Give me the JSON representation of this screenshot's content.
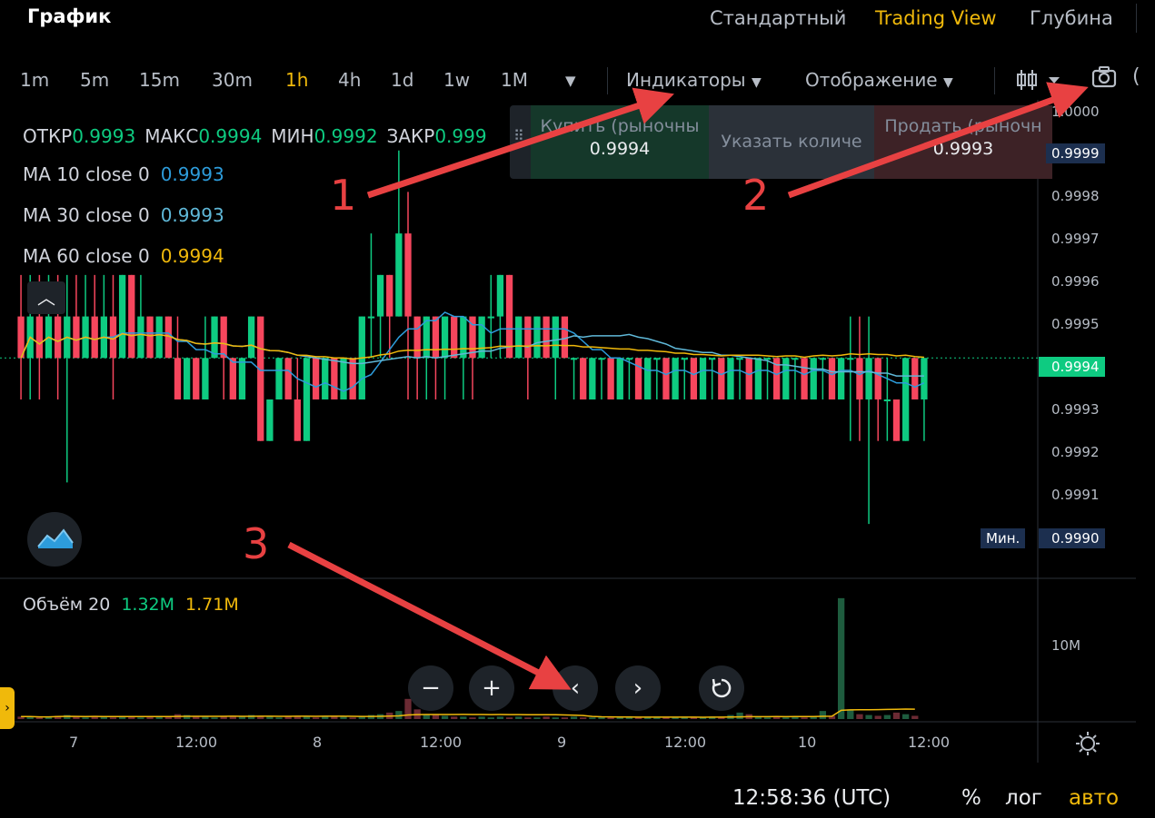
{
  "header": {
    "title": "График",
    "view_tabs": [
      "Стандартный",
      "Trading View",
      "Глубина"
    ],
    "active_view": "Trading View"
  },
  "timeframes": [
    "1m",
    "5m",
    "15m",
    "30m",
    "1h",
    "4h",
    "1d",
    "1w",
    "1M"
  ],
  "active_timeframe": "1h",
  "toolbar": {
    "indicators_label": "Индикаторы",
    "display_label": "Отображение",
    "dropdown_icon": "caret-down-icon",
    "chart_type_icon": "candlestick-icon",
    "screenshot_icon": "camera-icon"
  },
  "ohlc": {
    "open_label": "ОТКР",
    "open_value": "0.9993",
    "high_label": "МАКС",
    "high_value": "0.9994",
    "low_label": "МИН",
    "low_value": "0.9992",
    "close_label": "ЗАКР",
    "close_value": "0.999"
  },
  "ma": [
    {
      "label": "MA 10 close 0",
      "value": "0.9993",
      "color": "#2d9cdb"
    },
    {
      "label": "MA 30 close 0",
      "value": "0.9993",
      "color": "#5fb8d8"
    },
    {
      "label": "MA 60 close 0",
      "value": "0.9994",
      "color": "#f0b90b"
    }
  ],
  "trade_panel": {
    "buy_label": "Купить (рыночны",
    "buy_price": "0.9994",
    "qty_placeholder": "Указать количе",
    "sell_label": "Продать (рыночн",
    "sell_price": "0.9993"
  },
  "price_axis": {
    "top_partial": "1.0000",
    "labels": [
      "0.9998",
      "0.9997",
      "0.9996",
      "0.9995",
      "0.9993",
      "0.9992",
      "0.9991"
    ],
    "high_tag": "0.9999",
    "current_tag": "0.9994",
    "min_label": "Мин.",
    "min_tag": "0.9990"
  },
  "volume": {
    "label": "Объём 20",
    "value1": "1.32M",
    "value2": "1.71M",
    "axis_label": "10M"
  },
  "time_axis": [
    "7",
    "12:00",
    "8",
    "12:00",
    "9",
    "12:00",
    "10",
    "12:00"
  ],
  "nav_buttons": [
    "minus-icon",
    "plus-icon",
    "chevron-left-icon",
    "chevron-right-icon",
    "reset-icon"
  ],
  "annotations": [
    "1",
    "2",
    "3"
  ],
  "bottom_bar": {
    "clock": "12:58:36 (UTC)",
    "percent": "%",
    "log": "лог",
    "auto": "авто"
  },
  "colors": {
    "up": "#0ecb81",
    "down": "#f6465d",
    "accent": "#f0b90b",
    "annotation": "#e84142",
    "current_price": "#0ecb81"
  },
  "chart_data": {
    "type": "candlestick",
    "candles": [
      {
        "o": 0.9995,
        "h": 0.9996,
        "l": 0.9993,
        "c": 0.9994
      },
      {
        "o": 0.9994,
        "h": 0.9996,
        "l": 0.9993,
        "c": 0.9995
      },
      {
        "o": 0.9995,
        "h": 0.9996,
        "l": 0.9993,
        "c": 0.9994
      },
      {
        "o": 0.9994,
        "h": 0.9996,
        "l": 0.9994,
        "c": 0.9995
      },
      {
        "o": 0.9995,
        "h": 0.9996,
        "l": 0.9993,
        "c": 0.9994
      },
      {
        "o": 0.9994,
        "h": 0.9996,
        "l": 0.9991,
        "c": 0.9995
      },
      {
        "o": 0.9995,
        "h": 0.9996,
        "l": 0.9994,
        "c": 0.9994
      },
      {
        "o": 0.9994,
        "h": 0.9996,
        "l": 0.9994,
        "c": 0.9995
      },
      {
        "o": 0.9995,
        "h": 0.9996,
        "l": 0.9994,
        "c": 0.9994
      },
      {
        "o": 0.9994,
        "h": 0.9996,
        "l": 0.9994,
        "c": 0.9995
      },
      {
        "o": 0.9995,
        "h": 0.9996,
        "l": 0.9993,
        "c": 0.9994
      },
      {
        "o": 0.9994,
        "h": 0.9996,
        "l": 0.9994,
        "c": 0.9996
      },
      {
        "o": 0.9996,
        "h": 0.9996,
        "l": 0.9994,
        "c": 0.9994
      },
      {
        "o": 0.9994,
        "h": 0.9996,
        "l": 0.9994,
        "c": 0.9995
      },
      {
        "o": 0.9995,
        "h": 0.9995,
        "l": 0.9994,
        "c": 0.9994
      },
      {
        "o": 0.9994,
        "h": 0.9995,
        "l": 0.9994,
        "c": 0.9995
      },
      {
        "o": 0.9995,
        "h": 0.9995,
        "l": 0.9994,
        "c": 0.9994
      },
      {
        "o": 0.9994,
        "h": 0.9995,
        "l": 0.9993,
        "c": 0.9993
      },
      {
        "o": 0.9993,
        "h": 0.9994,
        "l": 0.9993,
        "c": 0.9994
      },
      {
        "o": 0.9994,
        "h": 0.9994,
        "l": 0.9993,
        "c": 0.9993
      },
      {
        "o": 0.9993,
        "h": 0.9995,
        "l": 0.9993,
        "c": 0.9994
      },
      {
        "o": 0.9994,
        "h": 0.9995,
        "l": 0.9994,
        "c": 0.9995
      },
      {
        "o": 0.9995,
        "h": 0.9995,
        "l": 0.9993,
        "c": 0.9994
      },
      {
        "o": 0.9994,
        "h": 0.9994,
        "l": 0.9993,
        "c": 0.9993
      },
      {
        "o": 0.9993,
        "h": 0.9994,
        "l": 0.9993,
        "c": 0.9994
      },
      {
        "o": 0.9994,
        "h": 0.9995,
        "l": 0.9994,
        "c": 0.9995
      },
      {
        "o": 0.9995,
        "h": 0.9995,
        "l": 0.9992,
        "c": 0.9992
      },
      {
        "o": 0.9992,
        "h": 0.9993,
        "l": 0.9992,
        "c": 0.9993
      },
      {
        "o": 0.9993,
        "h": 0.9994,
        "l": 0.9993,
        "c": 0.9994
      },
      {
        "o": 0.9994,
        "h": 0.9994,
        "l": 0.9993,
        "c": 0.9993
      },
      {
        "o": 0.9993,
        "h": 0.9994,
        "l": 0.9992,
        "c": 0.9992
      },
      {
        "o": 0.9992,
        "h": 0.9994,
        "l": 0.9992,
        "c": 0.9994
      },
      {
        "o": 0.9994,
        "h": 0.9994,
        "l": 0.9993,
        "c": 0.9993
      },
      {
        "o": 0.9993,
        "h": 0.9994,
        "l": 0.9993,
        "c": 0.9994
      },
      {
        "o": 0.9994,
        "h": 0.9994,
        "l": 0.9993,
        "c": 0.9993
      },
      {
        "o": 0.9993,
        "h": 0.9994,
        "l": 0.9993,
        "c": 0.9994
      },
      {
        "o": 0.9994,
        "h": 0.9994,
        "l": 0.9993,
        "c": 0.9993
      },
      {
        "o": 0.9993,
        "h": 0.9995,
        "l": 0.9993,
        "c": 0.9995
      },
      {
        "o": 0.9995,
        "h": 0.9997,
        "l": 0.9994,
        "c": 0.9995
      },
      {
        "o": 0.9995,
        "h": 0.9996,
        "l": 0.9994,
        "c": 0.9996
      },
      {
        "o": 0.9996,
        "h": 0.9996,
        "l": 0.9994,
        "c": 0.9995
      },
      {
        "o": 0.9995,
        "h": 0.9999,
        "l": 0.9995,
        "c": 0.9997
      },
      {
        "o": 0.9997,
        "h": 0.9998,
        "l": 0.9993,
        "c": 0.9995
      },
      {
        "o": 0.9995,
        "h": 0.9995,
        "l": 0.9993,
        "c": 0.9994
      },
      {
        "o": 0.9994,
        "h": 0.9995,
        "l": 0.9993,
        "c": 0.9995
      },
      {
        "o": 0.9995,
        "h": 0.9995,
        "l": 0.9993,
        "c": 0.9994
      },
      {
        "o": 0.9994,
        "h": 0.9995,
        "l": 0.9993,
        "c": 0.9995
      },
      {
        "o": 0.9995,
        "h": 0.9995,
        "l": 0.9994,
        "c": 0.9994
      },
      {
        "o": 0.9994,
        "h": 0.9995,
        "l": 0.9993,
        "c": 0.9995
      },
      {
        "o": 0.9995,
        "h": 0.9995,
        "l": 0.9993,
        "c": 0.9994
      },
      {
        "o": 0.9994,
        "h": 0.9995,
        "l": 0.9994,
        "c": 0.9995
      },
      {
        "o": 0.9995,
        "h": 0.9996,
        "l": 0.9994,
        "c": 0.9995
      },
      {
        "o": 0.9995,
        "h": 0.9996,
        "l": 0.9994,
        "c": 0.9996
      },
      {
        "o": 0.9996,
        "h": 0.9996,
        "l": 0.9994,
        "c": 0.9994
      },
      {
        "o": 0.9994,
        "h": 0.9995,
        "l": 0.9994,
        "c": 0.9995
      },
      {
        "o": 0.9995,
        "h": 0.9995,
        "l": 0.9993,
        "c": 0.9994
      },
      {
        "o": 0.9994,
        "h": 0.9995,
        "l": 0.9994,
        "c": 0.9995
      },
      {
        "o": 0.9995,
        "h": 0.9995,
        "l": 0.9994,
        "c": 0.9994
      },
      {
        "o": 0.9994,
        "h": 0.9995,
        "l": 0.9993,
        "c": 0.9995
      },
      {
        "o": 0.9995,
        "h": 0.9995,
        "l": 0.9994,
        "c": 0.9994
      },
      {
        "o": 0.9994,
        "h": 0.9994,
        "l": 0.9993,
        "c": 0.9994
      },
      {
        "o": 0.9994,
        "h": 0.9994,
        "l": 0.9993,
        "c": 0.9993
      },
      {
        "o": 0.9993,
        "h": 0.9994,
        "l": 0.9993,
        "c": 0.9994
      },
      {
        "o": 0.9994,
        "h": 0.9994,
        "l": 0.9993,
        "c": 0.9994
      },
      {
        "o": 0.9994,
        "h": 0.9994,
        "l": 0.9993,
        "c": 0.9993
      },
      {
        "o": 0.9993,
        "h": 0.9994,
        "l": 0.9993,
        "c": 0.9994
      },
      {
        "o": 0.9994,
        "h": 0.9994,
        "l": 0.9993,
        "c": 0.9994
      },
      {
        "o": 0.9994,
        "h": 0.9994,
        "l": 0.9993,
        "c": 0.9993
      },
      {
        "o": 0.9993,
        "h": 0.9994,
        "l": 0.9993,
        "c": 0.9994
      },
      {
        "o": 0.9994,
        "h": 0.9994,
        "l": 0.9993,
        "c": 0.9994
      },
      {
        "o": 0.9994,
        "h": 0.9994,
        "l": 0.9993,
        "c": 0.9993
      },
      {
        "o": 0.9993,
        "h": 0.9994,
        "l": 0.9993,
        "c": 0.9994
      },
      {
        "o": 0.9994,
        "h": 0.9994,
        "l": 0.9993,
        "c": 0.9994
      },
      {
        "o": 0.9994,
        "h": 0.9994,
        "l": 0.9993,
        "c": 0.9993
      },
      {
        "o": 0.9993,
        "h": 0.9994,
        "l": 0.9993,
        "c": 0.9994
      },
      {
        "o": 0.9994,
        "h": 0.9994,
        "l": 0.9993,
        "c": 0.9994
      },
      {
        "o": 0.9994,
        "h": 0.9994,
        "l": 0.9993,
        "c": 0.9993
      },
      {
        "o": 0.9993,
        "h": 0.9994,
        "l": 0.9993,
        "c": 0.9994
      },
      {
        "o": 0.9994,
        "h": 0.9994,
        "l": 0.9993,
        "c": 0.9994
      },
      {
        "o": 0.9994,
        "h": 0.9994,
        "l": 0.9993,
        "c": 0.9993
      },
      {
        "o": 0.9993,
        "h": 0.9994,
        "l": 0.9993,
        "c": 0.9994
      },
      {
        "o": 0.9994,
        "h": 0.9994,
        "l": 0.9993,
        "c": 0.9994
      },
      {
        "o": 0.9994,
        "h": 0.9994,
        "l": 0.9993,
        "c": 0.9993
      },
      {
        "o": 0.9993,
        "h": 0.9994,
        "l": 0.9993,
        "c": 0.9994
      },
      {
        "o": 0.9994,
        "h": 0.9994,
        "l": 0.9993,
        "c": 0.9994
      },
      {
        "o": 0.9994,
        "h": 0.9994,
        "l": 0.9993,
        "c": 0.9993
      },
      {
        "o": 0.9993,
        "h": 0.9994,
        "l": 0.9993,
        "c": 0.9994
      },
      {
        "o": 0.9994,
        "h": 0.9994,
        "l": 0.9993,
        "c": 0.9994
      },
      {
        "o": 0.9994,
        "h": 0.9994,
        "l": 0.9993,
        "c": 0.9993
      },
      {
        "o": 0.9993,
        "h": 0.9994,
        "l": 0.9993,
        "c": 0.9994
      },
      {
        "o": 0.9994,
        "h": 0.9995,
        "l": 0.9992,
        "c": 0.9994
      },
      {
        "o": 0.9994,
        "h": 0.9995,
        "l": 0.9992,
        "c": 0.9993
      },
      {
        "o": 0.9993,
        "h": 0.9995,
        "l": 0.999,
        "c": 0.9994
      },
      {
        "o": 0.9994,
        "h": 0.9994,
        "l": 0.9992,
        "c": 0.9993
      },
      {
        "o": 0.9993,
        "h": 0.9994,
        "l": 0.9992,
        "c": 0.9993
      },
      {
        "o": 0.9993,
        "h": 0.9993,
        "l": 0.9992,
        "c": 0.9992
      },
      {
        "o": 0.9992,
        "h": 0.9994,
        "l": 0.9992,
        "c": 0.9994
      },
      {
        "o": 0.9994,
        "h": 0.9994,
        "l": 0.9993,
        "c": 0.9993
      },
      {
        "o": 0.9993,
        "h": 0.9994,
        "l": 0.9992,
        "c": 0.9994
      }
    ],
    "volume": [
      0.3,
      0.3,
      0.2,
      0.3,
      0.4,
      0.5,
      0.3,
      0.2,
      0.4,
      0.3,
      0.2,
      0.4,
      0.3,
      0.2,
      0.3,
      0.4,
      0.3,
      0.6,
      0.5,
      0.4,
      0.3,
      0.2,
      0.3,
      0.4,
      0.3,
      0.5,
      0.4,
      0.3,
      0.2,
      0.3,
      0.4,
      0.3,
      0.2,
      0.3,
      0.4,
      0.3,
      0.2,
      0.3,
      0.5,
      0.6,
      0.8,
      1.0,
      2.5,
      1.2,
      0.6,
      0.5,
      0.4,
      0.3,
      0.3,
      0.2,
      0.3,
      0.2,
      0.3,
      0.2,
      0.3,
      0.2,
      0.2,
      0.3,
      0.2,
      0.2,
      0.3,
      0.2,
      0.2,
      0.3,
      0.2,
      0.2,
      0.3,
      0.2,
      0.2,
      0.3,
      0.2,
      0.2,
      0.3,
      0.2,
      0.2,
      0.3,
      0.2,
      0.5,
      0.8,
      0.6,
      0.3,
      0.2,
      0.3,
      0.2,
      0.3,
      0.2,
      0.3,
      1.0,
      0.4,
      15.0,
      1.2,
      0.6,
      0.5,
      0.4,
      0.5,
      0.8,
      0.6,
      0.4
    ],
    "ylim": [
      0.99895,
      1.0
    ],
    "volume_max": 16
  }
}
